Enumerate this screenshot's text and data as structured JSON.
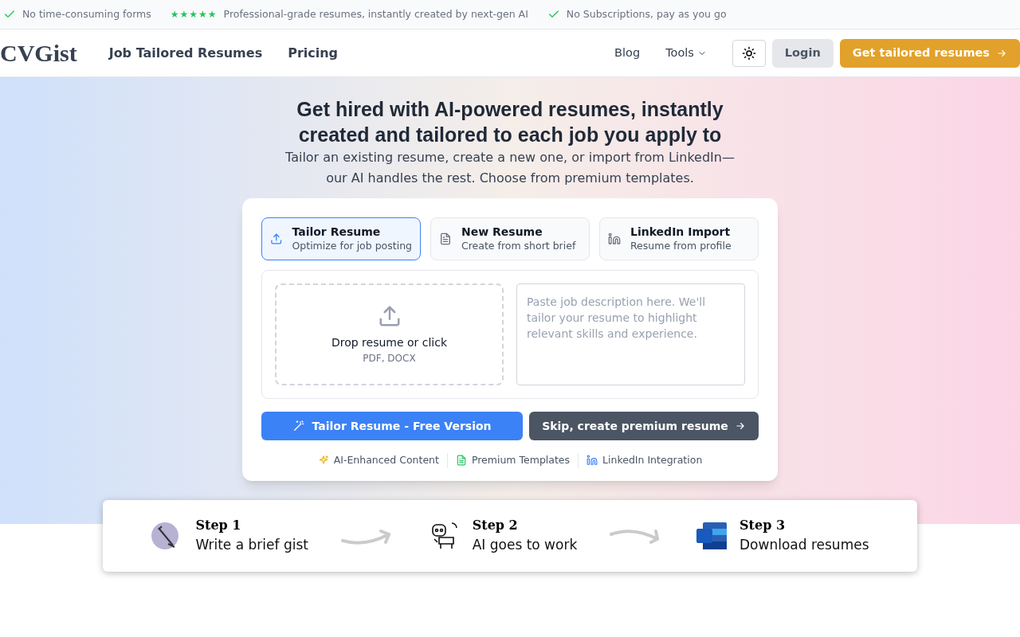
{
  "top_bar": [
    {
      "kind": "check",
      "text": "No time-consuming forms"
    },
    {
      "kind": "stars",
      "stars": 5,
      "text": "Professional-grade resumes, instantly created by next-gen AI"
    },
    {
      "kind": "check",
      "text": "No Subscriptions, pay as you go"
    }
  ],
  "nav": {
    "logo": "CVGist",
    "links": [
      "Job Tailored Resumes",
      "Pricing"
    ],
    "right_links": [
      {
        "label": "Blog",
        "dropdown": false
      },
      {
        "label": "Tools",
        "dropdown": true
      }
    ],
    "login": "Login",
    "cta": "Get tailored resumes"
  },
  "hero": {
    "title": "Get hired with AI-powered resumes, instantly created and tailored to each job you apply to",
    "subtitle": "Tailor an existing resume, create a new one, or import from LinkedIn—our AI handles the rest. Choose from premium templates."
  },
  "card": {
    "tabs": [
      {
        "kind": "upload",
        "title": "Tailor Resume",
        "subtitle": "Optimize for job posting",
        "selected": true
      },
      {
        "kind": "document",
        "title": "New Resume",
        "subtitle": "Create from short brief",
        "selected": false
      },
      {
        "kind": "linkedin",
        "title": "LinkedIn Import",
        "subtitle": "Resume from profile",
        "selected": false
      }
    ],
    "dropzone": {
      "label": "Drop resume or click",
      "formats": "PDF, DOCX"
    },
    "job_description": {
      "placeholder": "Paste job description here. We'll tailor your resume to highlight relevant skills and experience."
    },
    "primary_button": "Tailor Resume - Free Version",
    "secondary_button": "Skip, create premium resume",
    "features": [
      {
        "kind": "sparkle",
        "text": "AI-Enhanced Content"
      },
      {
        "kind": "document",
        "text": "Premium Templates"
      },
      {
        "kind": "linkedin",
        "text": "LinkedIn Integration"
      }
    ]
  },
  "steps": [
    {
      "kind": "pen",
      "title": "Step 1",
      "text": "Write a brief gist"
    },
    {
      "kind": "robot",
      "title": "Step 2",
      "text": "AI goes to work"
    },
    {
      "kind": "word",
      "title": "Step 3",
      "text": "Download resumes"
    }
  ]
}
